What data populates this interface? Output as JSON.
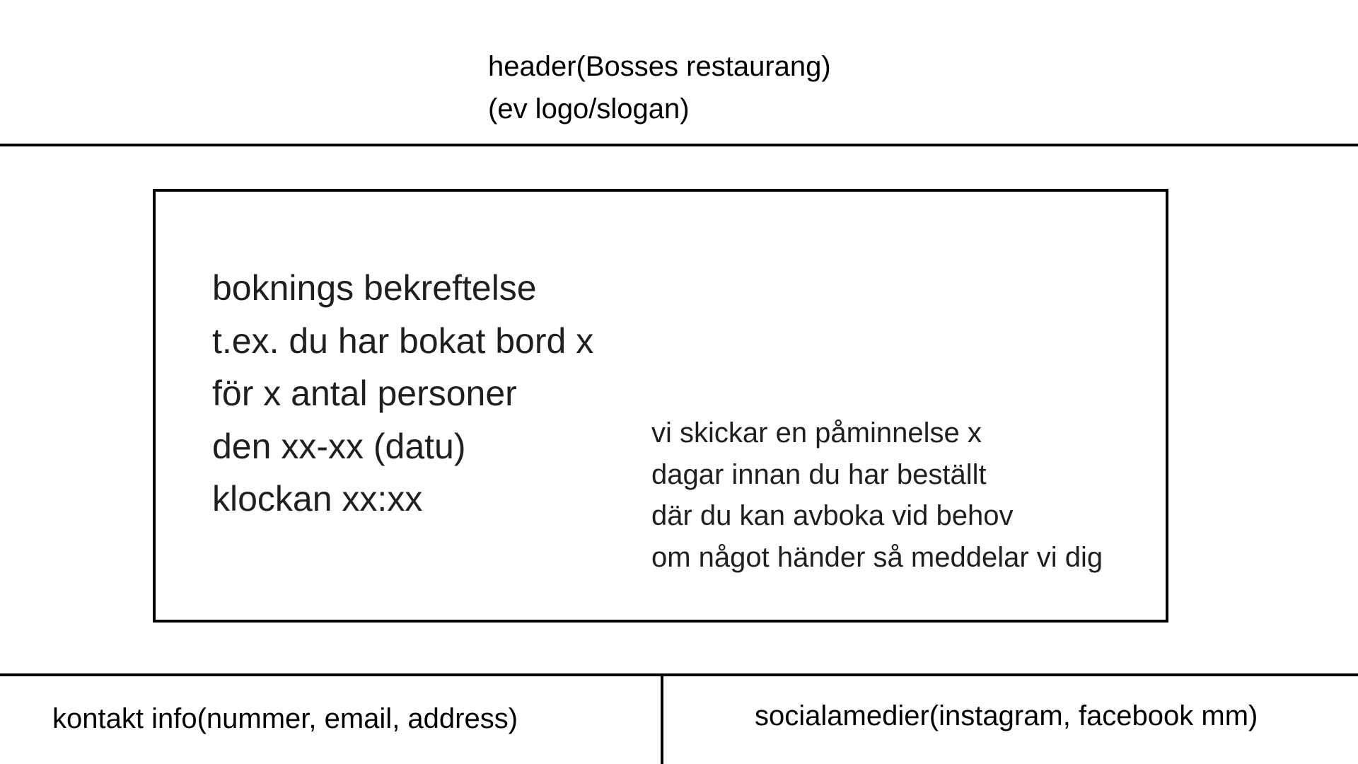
{
  "header": {
    "title": "header(Bosses restaurang)",
    "subtitle": "(ev logo/slogan)"
  },
  "confirmation": {
    "lines": [
      "boknings bekreftelse",
      "t.ex. du har bokat bord x",
      "för x antal personer",
      "den xx-xx (datu)",
      "klockan xx:xx"
    ]
  },
  "reminder": {
    "lines": [
      "vi skickar en påminnelse x",
      "dagar innan du har beställt",
      "där du kan avboka vid behov",
      "om något händer så meddelar vi dig"
    ]
  },
  "footer": {
    "contact": "kontakt info(nummer, email, address)",
    "social": "socialamedier(instagram, facebook mm)"
  }
}
